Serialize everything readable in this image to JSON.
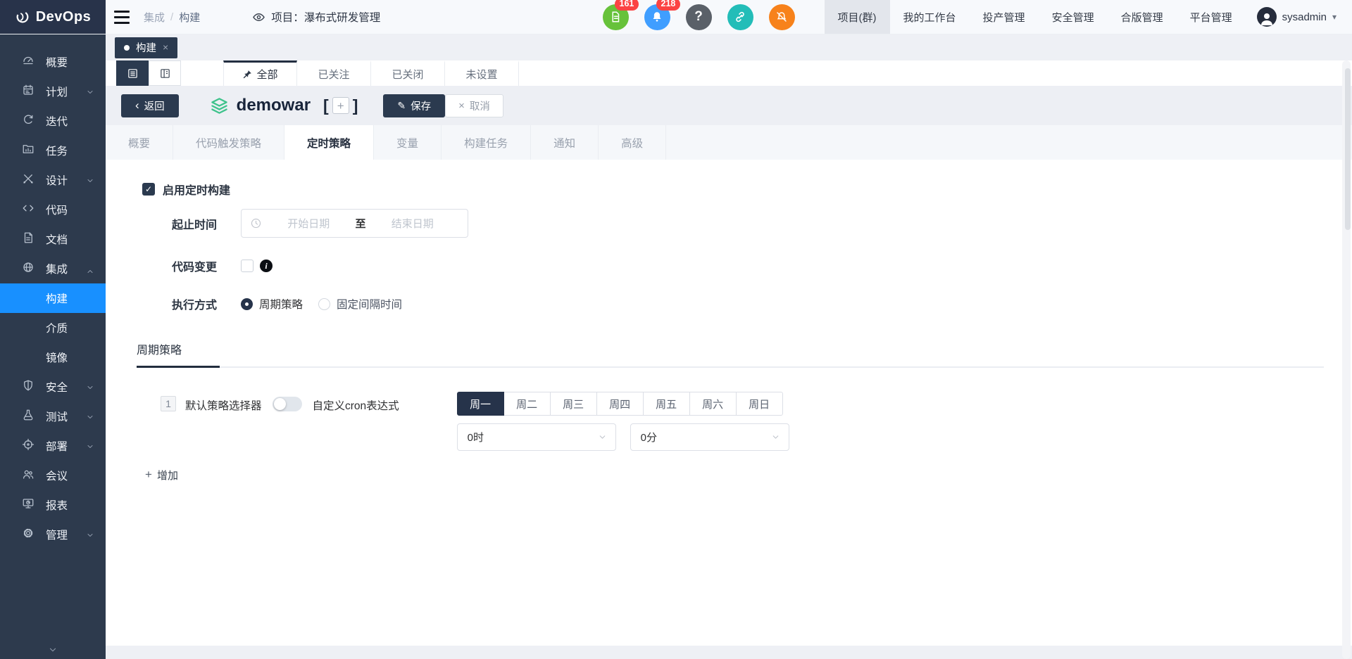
{
  "topbar": {
    "logo_text": "DevOps",
    "breadcrumb": {
      "section": "集成",
      "separator": "/",
      "current": "构建"
    },
    "project_label": "项目：瀑布式研发管理",
    "action_icons": [
      {
        "name": "document-icon",
        "color": "#67c23a",
        "count": "161"
      },
      {
        "name": "bell-icon",
        "color": "#409eff",
        "count": "218"
      },
      {
        "name": "help-icon",
        "color": "#5a6068"
      },
      {
        "name": "link-icon",
        "color": "#23bdb8"
      },
      {
        "name": "mute-icon",
        "color": "#f7821b"
      }
    ],
    "nav": [
      {
        "label": "项目(群)",
        "active": true
      },
      {
        "label": "我的工作台",
        "active": false
      },
      {
        "label": "投产管理",
        "active": false
      },
      {
        "label": "安全管理",
        "active": false
      },
      {
        "label": "合版管理",
        "active": false
      },
      {
        "label": "平台管理",
        "active": false
      }
    ],
    "user": {
      "name": "sysadmin"
    }
  },
  "window_tabs": [
    {
      "label": "构建",
      "active": true,
      "closable": true
    }
  ],
  "sidebar": {
    "items": [
      {
        "label": "概要",
        "icon": "dashboard-icon"
      },
      {
        "label": "计划",
        "icon": "calendar-icon",
        "expandable": true
      },
      {
        "label": "迭代",
        "icon": "iteration-icon"
      },
      {
        "label": "任务",
        "icon": "task-icon"
      },
      {
        "label": "设计",
        "icon": "design-icon",
        "expandable": true
      },
      {
        "label": "代码",
        "icon": "code-icon"
      },
      {
        "label": "文档",
        "icon": "file-icon"
      },
      {
        "label": "集成",
        "icon": "integration-icon",
        "expandable": true,
        "expanded": true
      },
      {
        "label": "构建",
        "sub": true,
        "active": true
      },
      {
        "label": "介质",
        "sub": true
      },
      {
        "label": "镜像",
        "sub": true
      },
      {
        "label": "安全",
        "icon": "shield-icon",
        "expandable": true
      },
      {
        "label": "测试",
        "icon": "flask-icon",
        "expandable": true
      },
      {
        "label": "部署",
        "icon": "crosshair-icon",
        "expandable": true
      },
      {
        "label": "会议",
        "icon": "people-icon"
      },
      {
        "label": "报表",
        "icon": "monitor-icon"
      },
      {
        "label": "管理",
        "icon": "gear-icon",
        "expandable": true
      }
    ]
  },
  "list_tabs": [
    {
      "label": "全部",
      "pinned": true,
      "active": true
    },
    {
      "label": "已关注",
      "active": false
    },
    {
      "label": "已关闭",
      "active": false
    },
    {
      "label": "未设置",
      "active": false
    }
  ],
  "header": {
    "back_label": "返回",
    "title": "demowar",
    "save_label": "保存",
    "cancel_label": "取消"
  },
  "detail_tabs": [
    {
      "label": "概要",
      "active": false
    },
    {
      "label": "代码触发策略",
      "active": false
    },
    {
      "label": "定时策略",
      "active": true
    },
    {
      "label": "变量",
      "active": false
    },
    {
      "label": "构建任务",
      "active": false
    },
    {
      "label": "通知",
      "active": false
    },
    {
      "label": "高级",
      "active": false
    }
  ],
  "form": {
    "enable_label": "启用定时构建",
    "enabled": true,
    "range_label": "起止时间",
    "start_placeholder": "开始日期",
    "to_label": "至",
    "end_placeholder": "结束日期",
    "code_change_label": "代码变更",
    "code_change_checked": false,
    "exec_mode_label": "执行方式",
    "exec_options": [
      {
        "label": "周期策略",
        "selected": true
      },
      {
        "label": "固定间隔时间",
        "selected": false
      }
    ],
    "section_title": "周期策略",
    "policy": {
      "index": "1",
      "selector_label": "默认策略选择器",
      "toggle_on": false,
      "cron_label": "自定义cron表达式",
      "days": [
        "周一",
        "周二",
        "周三",
        "周四",
        "周五",
        "周六",
        "周日"
      ],
      "selected_day": "周一",
      "hour_value": "0时",
      "minute_value": "0分"
    },
    "add_label": "增加"
  },
  "colors": {
    "sidebar_navy": "#2d3a4d",
    "button_navy": "#2b3a4f",
    "active_blue": "#1890ff",
    "badge_red": "#fb4343",
    "doc_green": "#67c23a",
    "bell_blue": "#409eff",
    "help_gray": "#5a6068",
    "link_teal": "#23bdb8",
    "mute_orange": "#f7821b",
    "layers_green": "#3fc38c"
  }
}
